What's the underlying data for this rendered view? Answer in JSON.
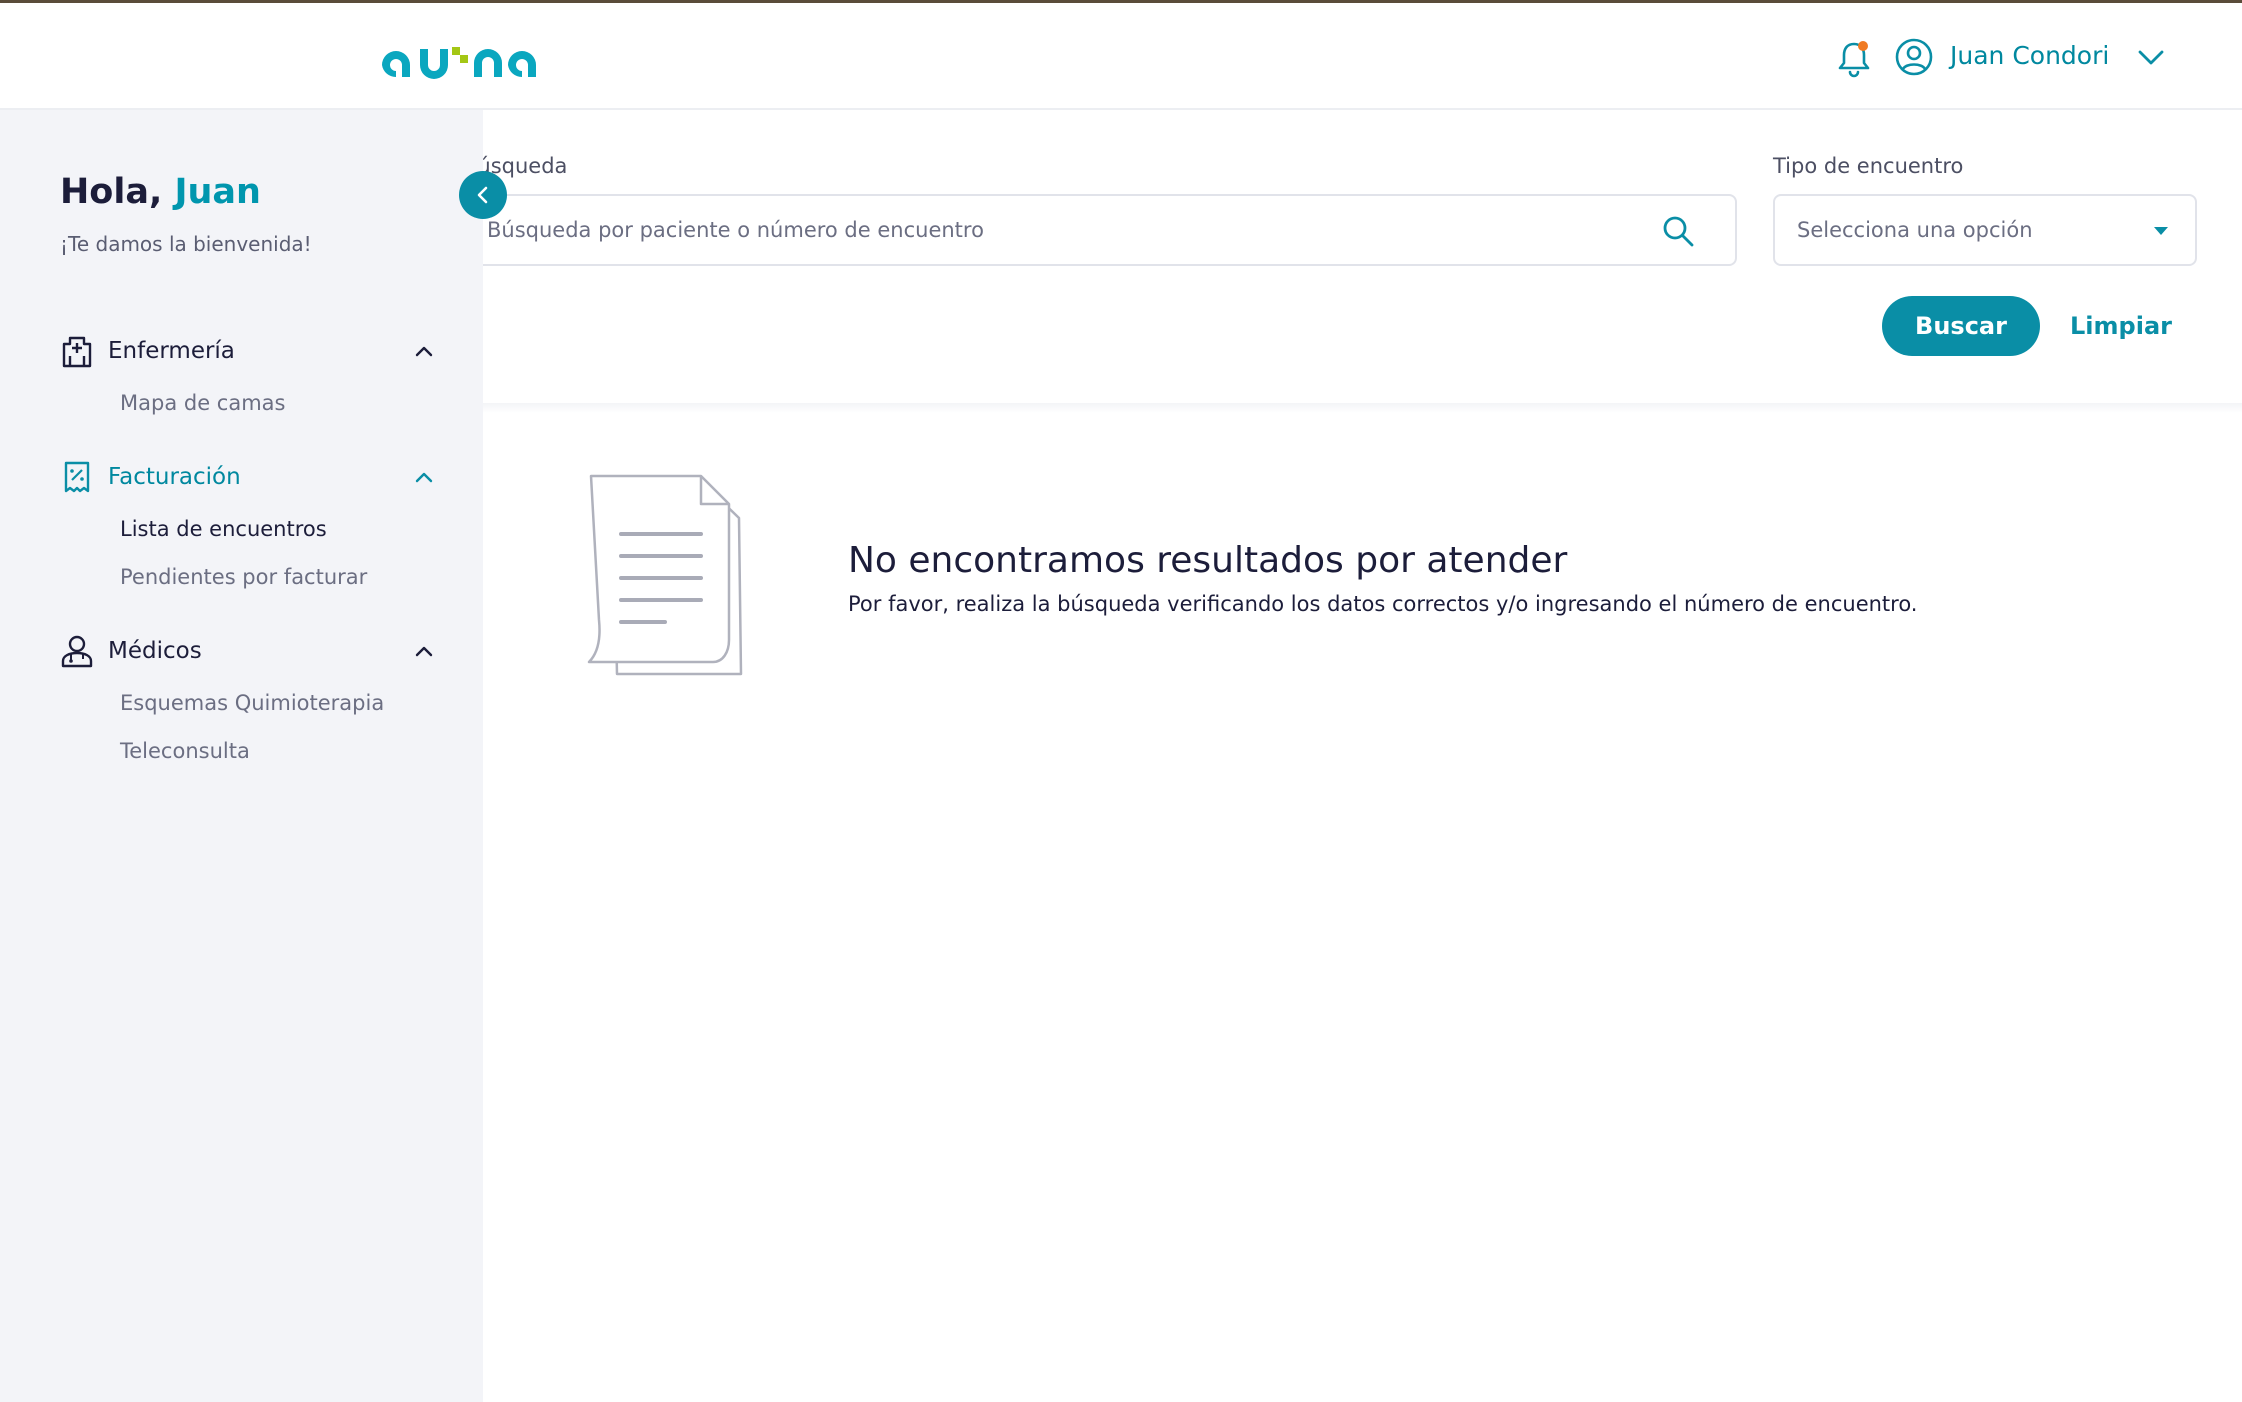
{
  "header": {
    "logo_text": "auna",
    "user_name": "Juan Condori"
  },
  "sidebar": {
    "greeting_prefix": "Hola,",
    "greeting_name": "Juan",
    "welcome": "¡Te damos la bienvenida!",
    "sections": [
      {
        "label": "Enfermería",
        "icon": "hospital-icon",
        "expanded": true,
        "items": [
          "Mapa de camas"
        ]
      },
      {
        "label": "Facturación",
        "icon": "invoice-icon",
        "expanded": true,
        "active": true,
        "items": [
          "Lista de encuentros",
          "Pendientes por facturar"
        ]
      },
      {
        "label": "Médicos",
        "icon": "doctor-icon",
        "expanded": true,
        "items": [
          "Esquemas Quimioterapia",
          "Teleconsulta"
        ]
      }
    ],
    "current_item": "Lista de encuentros"
  },
  "filters": {
    "search_label": "Búsqueda",
    "search_placeholder": "Búsqueda por paciente o número de encuentro",
    "type_label": "Tipo de encuentro",
    "type_placeholder": "Selecciona una opción",
    "buscar_label": "Buscar",
    "limpiar_label": "Limpiar"
  },
  "empty_state": {
    "title": "No encontramos resultados por atender",
    "description": "Por favor, realiza la búsqueda verificando los datos correctos y/o ingresando el número de encuentro."
  },
  "colors": {
    "brand": "#0a8ea6",
    "brand_text": "#00889f",
    "logo_green": "#a4c715",
    "notification_dot": "#f07a23",
    "sidebar_bg": "#f3f4f8"
  }
}
